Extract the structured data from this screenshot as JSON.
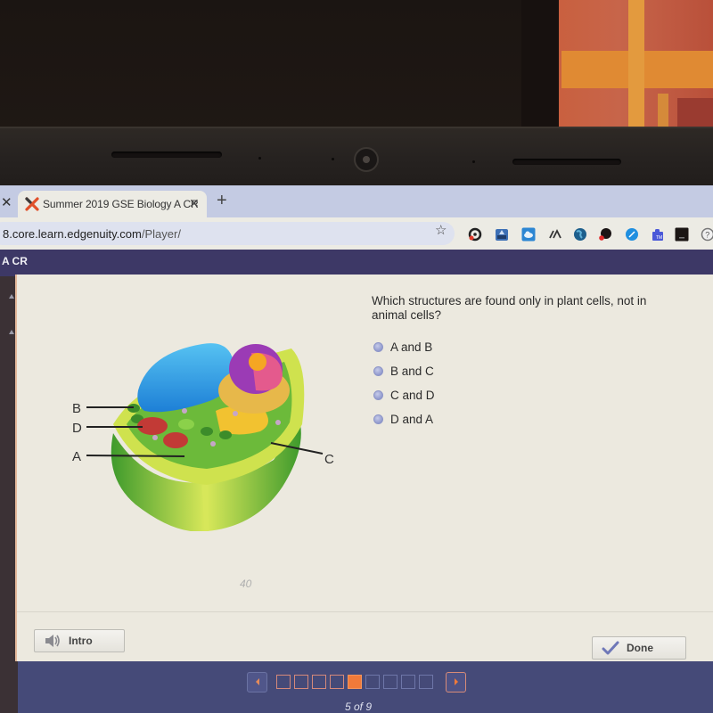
{
  "browser": {
    "tab_title": "Summer 2019 GSE Biology A CR",
    "tab_close_icon": "close-icon",
    "new_tab_icon": "plus-icon",
    "url_host": "8.core.learn.edgenuity.com",
    "url_path": "/Player/",
    "extensions": [
      "target-icon",
      "inbox-icon",
      "cloud-icon",
      "logo-icon",
      "globe-icon",
      "paint-icon",
      "compass-icon",
      "puzzle-icon",
      "dark-square-icon",
      "help-icon"
    ]
  },
  "course": {
    "header_title": "A CR"
  },
  "question": {
    "text": "Which structures are found only in plant cells, not in animal cells?",
    "options": [
      {
        "label": "A and B",
        "selected": false
      },
      {
        "label": "B and C",
        "selected": false
      },
      {
        "label": "C and D",
        "selected": false
      },
      {
        "label": "D and A",
        "selected": false
      }
    ]
  },
  "diagram": {
    "subject": "plant cell",
    "labels": [
      "B",
      "D",
      "A",
      "C"
    ]
  },
  "handwriting": "40",
  "footer": {
    "intro_label": "Intro",
    "done_label": "Done"
  },
  "pager": {
    "current": 5,
    "total": 9,
    "label": "5 of 9"
  },
  "colors": {
    "accent_orange": "#f07a3a",
    "header_purple": "#3d3866",
    "radio_blue": "#7b85c2"
  }
}
